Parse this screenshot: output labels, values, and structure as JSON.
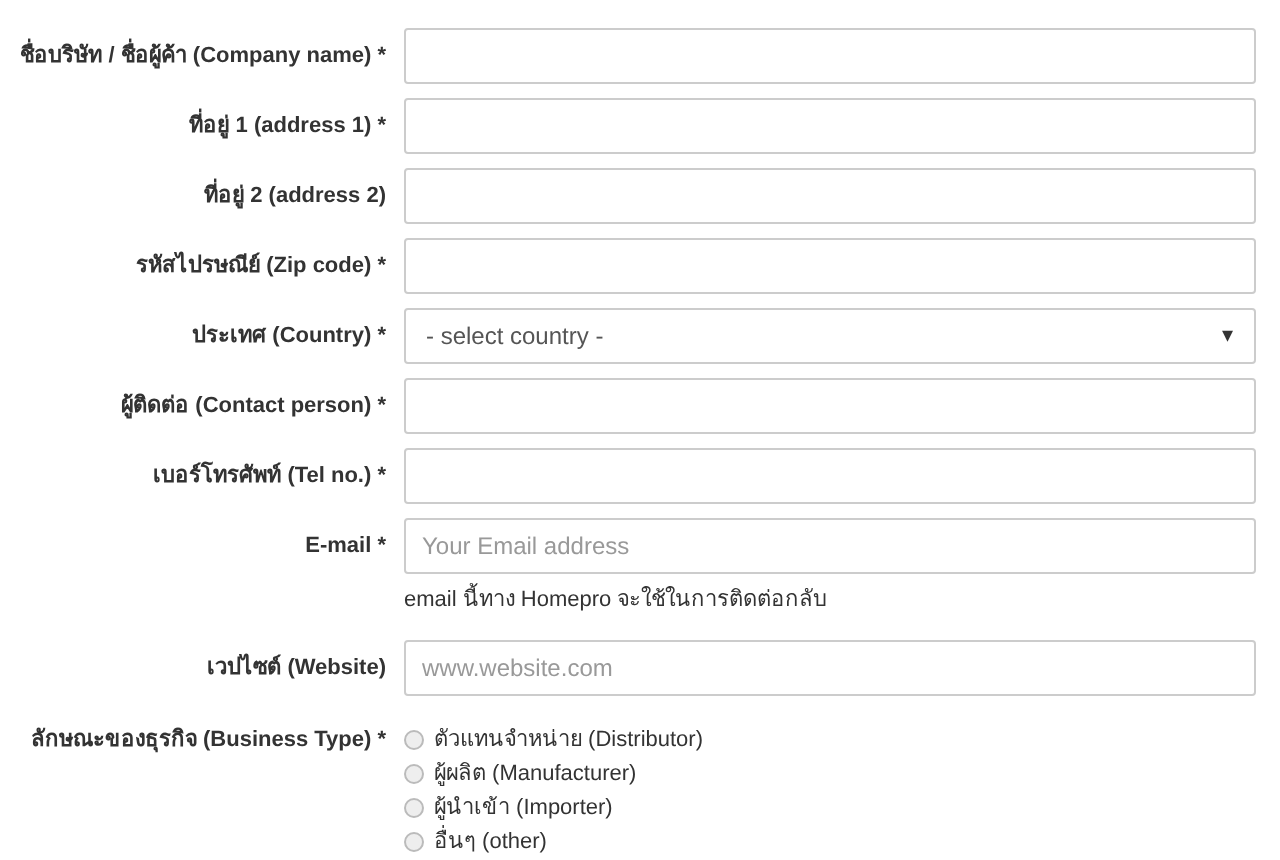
{
  "fields": [
    {
      "label": "ชื่อบริษัท / ชื่อผู้ค้า (Company name) *",
      "kind": "input"
    },
    {
      "label": "ที่อยู่ 1 (address 1) *",
      "kind": "input"
    },
    {
      "label": "ที่อยู่ 2 (address 2)",
      "kind": "input"
    },
    {
      "label": "รหัสไปรษณีย์ (Zip code) *",
      "kind": "input"
    },
    {
      "label": "ประเทศ (Country) *",
      "kind": "select",
      "value": "- select country -",
      "arrow": "▾"
    },
    {
      "label": "ผู้ติดต่อ (Contact person) *",
      "kind": "input"
    },
    {
      "label": "เบอร์โทรศัพท์ (Tel no.) *",
      "kind": "input"
    },
    {
      "label": "E-mail *",
      "kind": "input",
      "placeholder": "Your Email address",
      "help": "email นี้ทาง Homepro จะใช้ในการติดต่อกลับ"
    },
    {
      "label": "เวปไซต์ (Website)",
      "kind": "input",
      "placeholder": "www.website.com"
    }
  ],
  "business_type": {
    "label": "ลักษณะของธุรกิจ (Business Type) *",
    "options": [
      {
        "label": "ตัวแทนจำหน่าย (Distributor)",
        "selected": false
      },
      {
        "label": "ผู้ผลิต (Manufacturer)",
        "selected": false
      },
      {
        "label": "ผู้นำเข้า (Importer)",
        "selected": false
      },
      {
        "label": "อื่นๆ (other)",
        "selected": false
      }
    ]
  }
}
